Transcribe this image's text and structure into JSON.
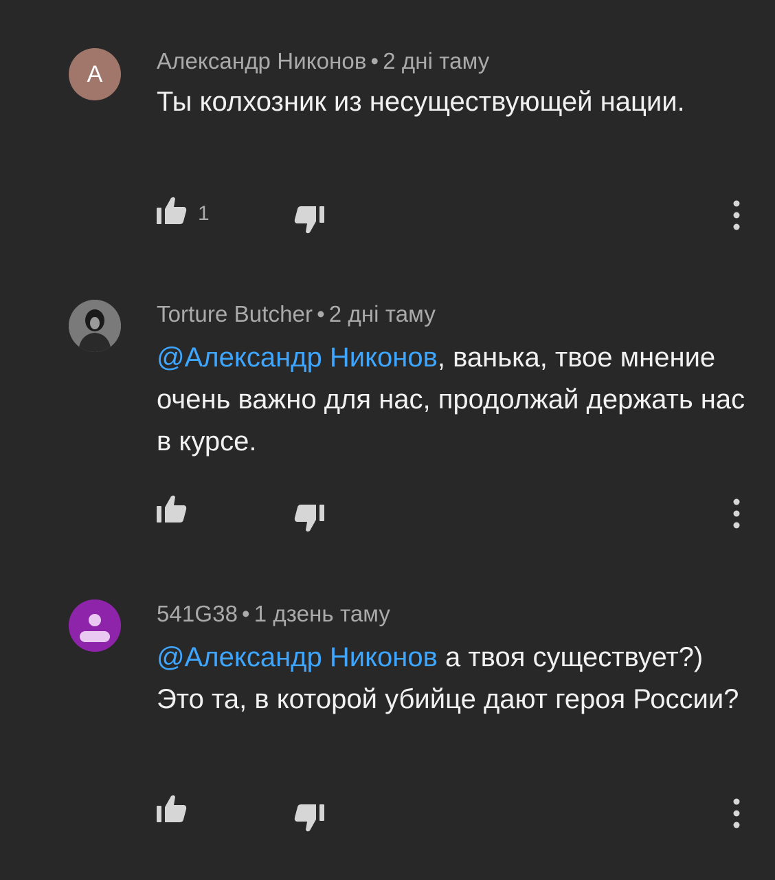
{
  "comments": [
    {
      "avatar_letter": "A",
      "avatar_color": "#a1776c",
      "author": "Александр Никонов",
      "separator": "•",
      "time": "2 дні таму",
      "mention": "",
      "text_after_mention": "Ты колхозник из несуществующей нации.",
      "likes": "1",
      "like_icon": "thumbs-up-icon",
      "dislike_icon": "thumbs-down-icon",
      "more_icon": "more-vertical-icon"
    },
    {
      "avatar_letter": "",
      "avatar_color": "#6f6f6f",
      "author": "Torture Butcher",
      "separator": "•",
      "time": "2 дні таму",
      "mention": "@Александр Никонов",
      "text_after_mention": ", ванька, твое мнение очень важно для нас, продолжай держать нас в курсе.",
      "likes": "",
      "like_icon": "thumbs-up-icon",
      "dislike_icon": "thumbs-down-icon",
      "more_icon": "more-vertical-icon"
    },
    {
      "avatar_letter": "",
      "avatar_color": "#8e24aa",
      "author": "541G38",
      "separator": "•",
      "time": "1 дзень таму",
      "mention": "@Александр Никонов",
      "text_after_mention": " а твоя существует?) Это та, в которой убийце дают героя России?",
      "likes": "",
      "like_icon": "thumbs-up-icon",
      "dislike_icon": "thumbs-down-icon",
      "more_icon": "more-vertical-icon"
    }
  ],
  "colors": {
    "background": "#282828",
    "text": "#f1f1f1",
    "meta": "#aaaaaa",
    "mention": "#3ea6ff",
    "icon": "#d6d6d6"
  }
}
